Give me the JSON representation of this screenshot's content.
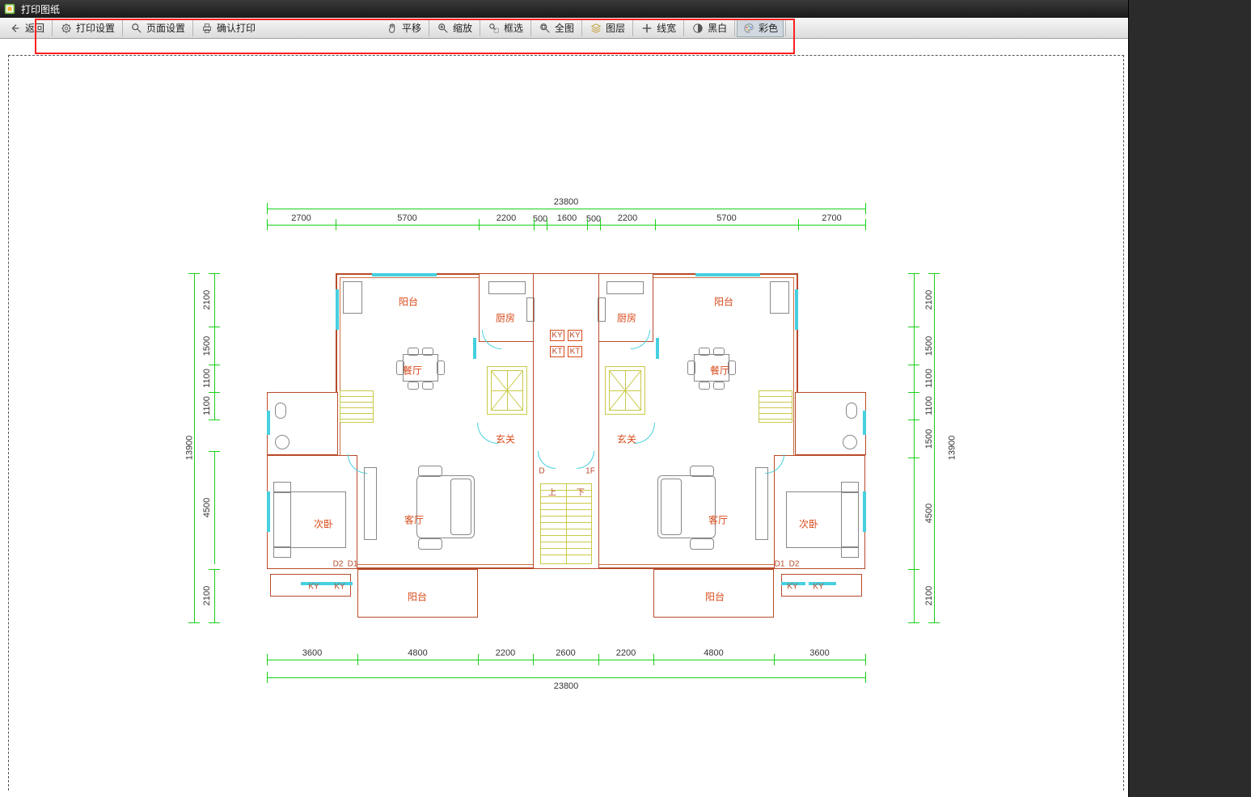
{
  "app": {
    "title": "打印图纸"
  },
  "toolbar_left": {
    "back": "返回",
    "print_settings": "打印设置",
    "page_setup": "页面设置",
    "confirm_print": "确认打印"
  },
  "toolbar_center": {
    "pan": "平移",
    "zoom": "缩放",
    "box_select": "框选",
    "full_view": "全图",
    "layers": "图层",
    "line_width": "线宽",
    "blackwhite": "黑白",
    "color": "彩色"
  },
  "dims_top_total": "23800",
  "dims_top": [
    "2700",
    "5700",
    "2200",
    "500",
    "1600",
    "500",
    "2200",
    "5700",
    "2700"
  ],
  "dims_left_total": "13900",
  "dims_left": [
    "2100",
    "1500",
    "1100",
    "1100",
    "4500",
    "2100"
  ],
  "dims_right_total": "13900",
  "dims_right": [
    "2100",
    "1500",
    "1100",
    "1100",
    "1500",
    "4500",
    "2100"
  ],
  "dims_bottom_total": "23800",
  "dims_bottom": [
    "3600",
    "4800",
    "2200",
    "2600",
    "2200",
    "4800",
    "3600"
  ],
  "rooms": {
    "balcony": "阳台",
    "kitchen": "厨房",
    "dining": "餐厅",
    "foyer": "玄关",
    "living": "客厅",
    "secondary_br": "次卧"
  },
  "marks": {
    "up": "上",
    "down": "下",
    "d": "D",
    "f": "1F",
    "ky": "KY",
    "kt": "KT",
    "d1": "D1",
    "d2": "D2"
  }
}
